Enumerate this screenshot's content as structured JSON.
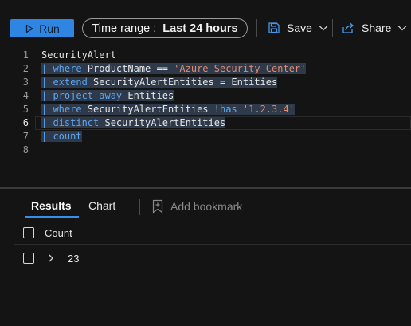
{
  "toolbar": {
    "run_label": "Run",
    "time_range_label": "Time range :",
    "time_range_value": "Last 24 hours",
    "save_label": "Save",
    "share_label": "Share"
  },
  "editor": {
    "line_numbers": [
      "1",
      "2",
      "3",
      "4",
      "5",
      "6",
      "7",
      "8"
    ],
    "lines": [
      [
        {
          "t": "SecurityAlert",
          "c": "txt"
        }
      ],
      [
        {
          "t": "| ",
          "c": "pipe"
        },
        {
          "t": "where",
          "c": "kw"
        },
        {
          "t": " ProductName == ",
          "c": "txt"
        },
        {
          "t": "'Azure Security Center'",
          "c": "str"
        }
      ],
      [
        {
          "t": "| ",
          "c": "pipe"
        },
        {
          "t": "extend",
          "c": "kw"
        },
        {
          "t": " SecurityAlertEntities = Entities",
          "c": "txt"
        }
      ],
      [
        {
          "t": "| ",
          "c": "pipe"
        },
        {
          "t": "project-away",
          "c": "kw"
        },
        {
          "t": " Entities",
          "c": "txt"
        }
      ],
      [
        {
          "t": "| ",
          "c": "pipe"
        },
        {
          "t": "where",
          "c": "kw"
        },
        {
          "t": " SecurityAlertEntities !",
          "c": "txt"
        },
        {
          "t": "has",
          "c": "kw"
        },
        {
          "t": " ",
          "c": "txt"
        },
        {
          "t": "'1.2.3.4'",
          "c": "str"
        }
      ],
      [
        {
          "t": "| ",
          "c": "pipe"
        },
        {
          "t": "distinct",
          "c": "kw"
        },
        {
          "t": " SecurityAlertEntities",
          "c": "txt"
        }
      ],
      [
        {
          "t": "| ",
          "c": "pipe"
        },
        {
          "t": "count",
          "c": "kw"
        }
      ],
      []
    ]
  },
  "results": {
    "tabs": [
      {
        "label": "Results",
        "active": true
      },
      {
        "label": "Chart",
        "active": false
      }
    ],
    "add_bookmark_label": "Add bookmark",
    "columns": [
      "Count"
    ],
    "rows": [
      [
        "23"
      ]
    ]
  },
  "colors": {
    "accent": "#2f86e2",
    "keyword": "#5ea4f0",
    "string": "#e28a6e",
    "background": "#141414"
  }
}
